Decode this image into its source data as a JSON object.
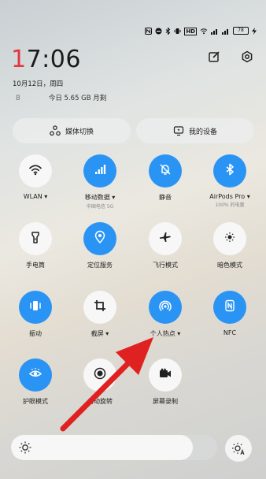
{
  "clock": {
    "hour": "1",
    "rest": "7:06"
  },
  "date": "10月12日，周四",
  "data_usage": {
    "unit": "B",
    "today": "今日 5.65 GB 月剩"
  },
  "media_switch": "媒体切换",
  "my_devices": "我的设备",
  "status_bar": {
    "hd": "HD",
    "battery": "78"
  },
  "tiles": [
    {
      "id": "wlan",
      "label": "WLAN",
      "sub": "",
      "on": false,
      "icon": "wifi-icon"
    },
    {
      "id": "mobile-data",
      "label": "移动数据",
      "sub": "中国电信 5G",
      "on": true,
      "icon": "signal-bars-icon"
    },
    {
      "id": "mute",
      "label": "静音",
      "sub": "",
      "on": true,
      "icon": "bell-mute-icon"
    },
    {
      "id": "airpods",
      "label": "AirPods Pro",
      "sub": "100% 的电量",
      "on": true,
      "icon": "bluetooth-icon"
    },
    {
      "id": "flashlight",
      "label": "手电筒",
      "sub": "",
      "on": false,
      "icon": "flashlight-icon"
    },
    {
      "id": "location",
      "label": "定位服务",
      "sub": "",
      "on": true,
      "icon": "location-icon"
    },
    {
      "id": "airplane",
      "label": "飞行模式",
      "sub": "",
      "on": false,
      "icon": "airplane-icon"
    },
    {
      "id": "dark-mode",
      "label": "暗色模式",
      "sub": "",
      "on": false,
      "icon": "dark-mode-icon"
    },
    {
      "id": "vibrate",
      "label": "振动",
      "sub": "",
      "on": true,
      "icon": "vibrate-icon"
    },
    {
      "id": "screenshot",
      "label": "截屏",
      "sub": "",
      "on": false,
      "icon": "crop-icon"
    },
    {
      "id": "hotspot",
      "label": "个人热点",
      "sub": "",
      "on": true,
      "icon": "hotspot-icon"
    },
    {
      "id": "nfc",
      "label": "NFC",
      "sub": "",
      "on": true,
      "icon": "nfc-icon"
    },
    {
      "id": "eye-care",
      "label": "护眼模式",
      "sub": "",
      "on": true,
      "icon": "eye-icon"
    },
    {
      "id": "auto-rotate",
      "label": "自动旋转",
      "sub": "",
      "on": false,
      "icon": "record-icon"
    },
    {
      "id": "screen-record",
      "label": "屏幕录制",
      "sub": "",
      "on": false,
      "icon": "video-camera-icon"
    }
  ],
  "brightness": {
    "level_percent": 88
  },
  "colors": {
    "accent": "#2a94f5",
    "clock_accent": "#e0383e",
    "annotation_arrow": "#e02121"
  }
}
